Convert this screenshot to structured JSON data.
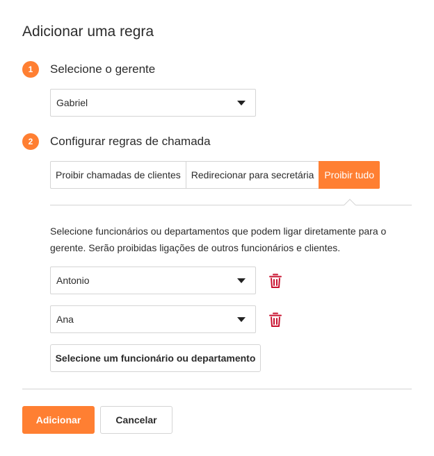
{
  "title": "Adicionar uma regra",
  "step1": {
    "number": "1",
    "label": "Selecione o gerente",
    "manager_value": "Gabriel"
  },
  "step2": {
    "number": "2",
    "label": "Configurar regras de chamada",
    "tabs": [
      {
        "label": "Proibir chamadas de clientes",
        "active": false
      },
      {
        "label": "Redirecionar para secretária",
        "active": false
      },
      {
        "label": "Proibir tudo",
        "active": true
      }
    ],
    "description": "Selecione funcionários ou departamentos que podem ligar diretamente para o gerente. Serão proibidas ligações de outros funcionários e clientes.",
    "allowed": [
      {
        "value": "Antonio",
        "delete_icon": "trash-icon"
      },
      {
        "value": "Ana",
        "delete_icon": "trash-icon"
      }
    ],
    "add_selector_label": "Selecione um funcionário ou departamento"
  },
  "footer": {
    "add_label": "Adicionar",
    "cancel_label": "Cancelar"
  },
  "colors": {
    "accent": "#ff7f32",
    "delete": "#c8102e",
    "border": "#d4d4d4"
  }
}
